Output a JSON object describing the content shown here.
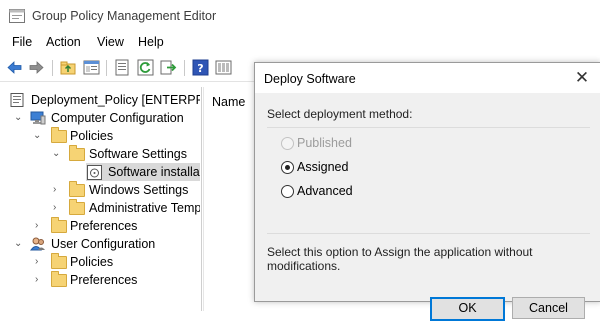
{
  "window": {
    "title": "Group Policy Management Editor"
  },
  "menu": {
    "items": [
      "File",
      "Action",
      "View",
      "Help"
    ]
  },
  "toolbar": {
    "icons": [
      "back-arrow-icon",
      "forward-arrow-icon",
      "folder-up-icon",
      "show-tree-icon",
      "properties-icon",
      "refresh-icon",
      "export-icon",
      "help-icon",
      "extra-view-icon"
    ]
  },
  "tree": {
    "root": "Deployment_Policy [ENTERPRIS",
    "computer_config": "Computer Configuration",
    "policies": "Policies",
    "software_settings": "Software Settings",
    "software_installation": "Software installat",
    "windows_settings": "Windows Settings",
    "admin_templates": "Administrative Temp",
    "preferences": "Preferences",
    "user_config": "User Configuration",
    "user_policies": "Policies",
    "user_preferences": "Preferences"
  },
  "list": {
    "column_name": "Name"
  },
  "dialog": {
    "title": "Deploy Software",
    "close_label": "✕",
    "prompt": "Select deployment method:",
    "options": [
      {
        "label": "Published",
        "enabled": false,
        "checked": false
      },
      {
        "label": "Assigned",
        "enabled": true,
        "checked": true
      },
      {
        "label": "Advanced",
        "enabled": true,
        "checked": false
      }
    ],
    "description": "Select this option to Assign the application without modifications.",
    "ok_label": "OK",
    "cancel_label": "Cancel"
  }
}
